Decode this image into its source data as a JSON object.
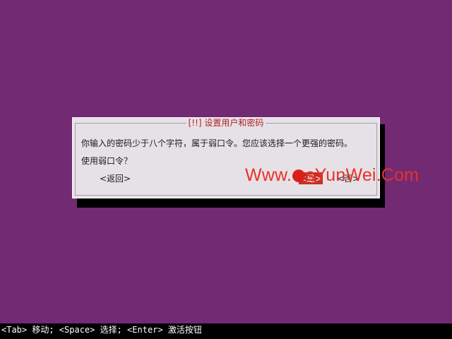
{
  "dialog": {
    "title": "[!!] 设置用户和密码",
    "message": "你输入的密码少于八个字符，属于弱口令。您应该选择一个更强的密码。",
    "question": "使用弱口令？",
    "buttons": {
      "back": "<返回>",
      "yes": "<是>",
      "no": "<否>"
    }
  },
  "watermark": {
    "prefix": "Www.",
    "suffix": "sYunWei.Com"
  },
  "statusbar": {
    "hint": "<Tab> 移动; <Space> 选择; <Enter> 激活按钮"
  },
  "colors": {
    "background": "#722a73",
    "dialog": "#e6e1e6",
    "title": "#b22222",
    "watermark": "#e8312a",
    "statusbar": "#000000"
  }
}
